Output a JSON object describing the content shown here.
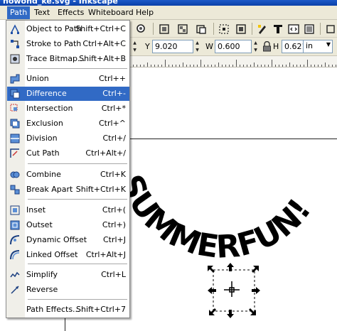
{
  "window": {
    "title": "nowond_ke.svg - Inkscape"
  },
  "menubar": [
    {
      "label": "Path",
      "active": true
    },
    {
      "label": "Text"
    },
    {
      "label": "Effects"
    },
    {
      "label": "Whiteboard"
    },
    {
      "label": "Help"
    }
  ],
  "path_menu": [
    {
      "label": "Object to Path",
      "shortcut": "Shift+Ctrl+C",
      "icon": "object-to-path-icon"
    },
    {
      "label": "Stroke to Path",
      "shortcut": "Ctrl+Alt+C",
      "icon": "stroke-to-path-icon"
    },
    {
      "label": "Trace Bitmap...",
      "shortcut": "Shift+Alt+B",
      "icon": "trace-bitmap-icon"
    },
    {
      "label": "Union",
      "shortcut": "Ctrl++",
      "icon": "union-icon"
    },
    {
      "label": "Difference",
      "shortcut": "Ctrl+-",
      "icon": "difference-icon",
      "highlighted": true
    },
    {
      "label": "Intersection",
      "shortcut": "Ctrl+*",
      "icon": "intersection-icon"
    },
    {
      "label": "Exclusion",
      "shortcut": "Ctrl+^",
      "icon": "exclusion-icon"
    },
    {
      "label": "Division",
      "shortcut": "Ctrl+/",
      "icon": "division-icon"
    },
    {
      "label": "Cut Path",
      "shortcut": "Ctrl+Alt+/",
      "icon": "cut-path-icon"
    },
    {
      "label": "Combine",
      "shortcut": "Ctrl+K",
      "icon": "combine-icon"
    },
    {
      "label": "Break Apart",
      "shortcut": "Shift+Ctrl+K",
      "icon": "break-apart-icon"
    },
    {
      "label": "Inset",
      "shortcut": "Ctrl+(",
      "icon": "inset-icon"
    },
    {
      "label": "Outset",
      "shortcut": "Ctrl+)",
      "icon": "outset-icon"
    },
    {
      "label": "Dynamic Offset",
      "shortcut": "Ctrl+J",
      "icon": "dynamic-offset-icon"
    },
    {
      "label": "Linked Offset",
      "shortcut": "Ctrl+Alt+J",
      "icon": "linked-offset-icon"
    },
    {
      "label": "Simplify",
      "shortcut": "Ctrl+L",
      "icon": "simplify-icon"
    },
    {
      "label": "Reverse",
      "shortcut": "",
      "icon": "reverse-icon"
    },
    {
      "label": "Path Effects...",
      "shortcut": "Shift+Ctrl+7",
      "icon": ""
    }
  ],
  "controls": {
    "y_label": "Y",
    "y_value": "9.020",
    "w_label": "W",
    "w_value": "0.600",
    "h_label": "H",
    "h_value": "0.621",
    "unit": "in"
  },
  "canvas_text": "SUMMERFUN!",
  "colors": {
    "menu_highlight": "#316ac5",
    "chrome": "#ece9d8",
    "title_bar": "#0a3fa8"
  }
}
